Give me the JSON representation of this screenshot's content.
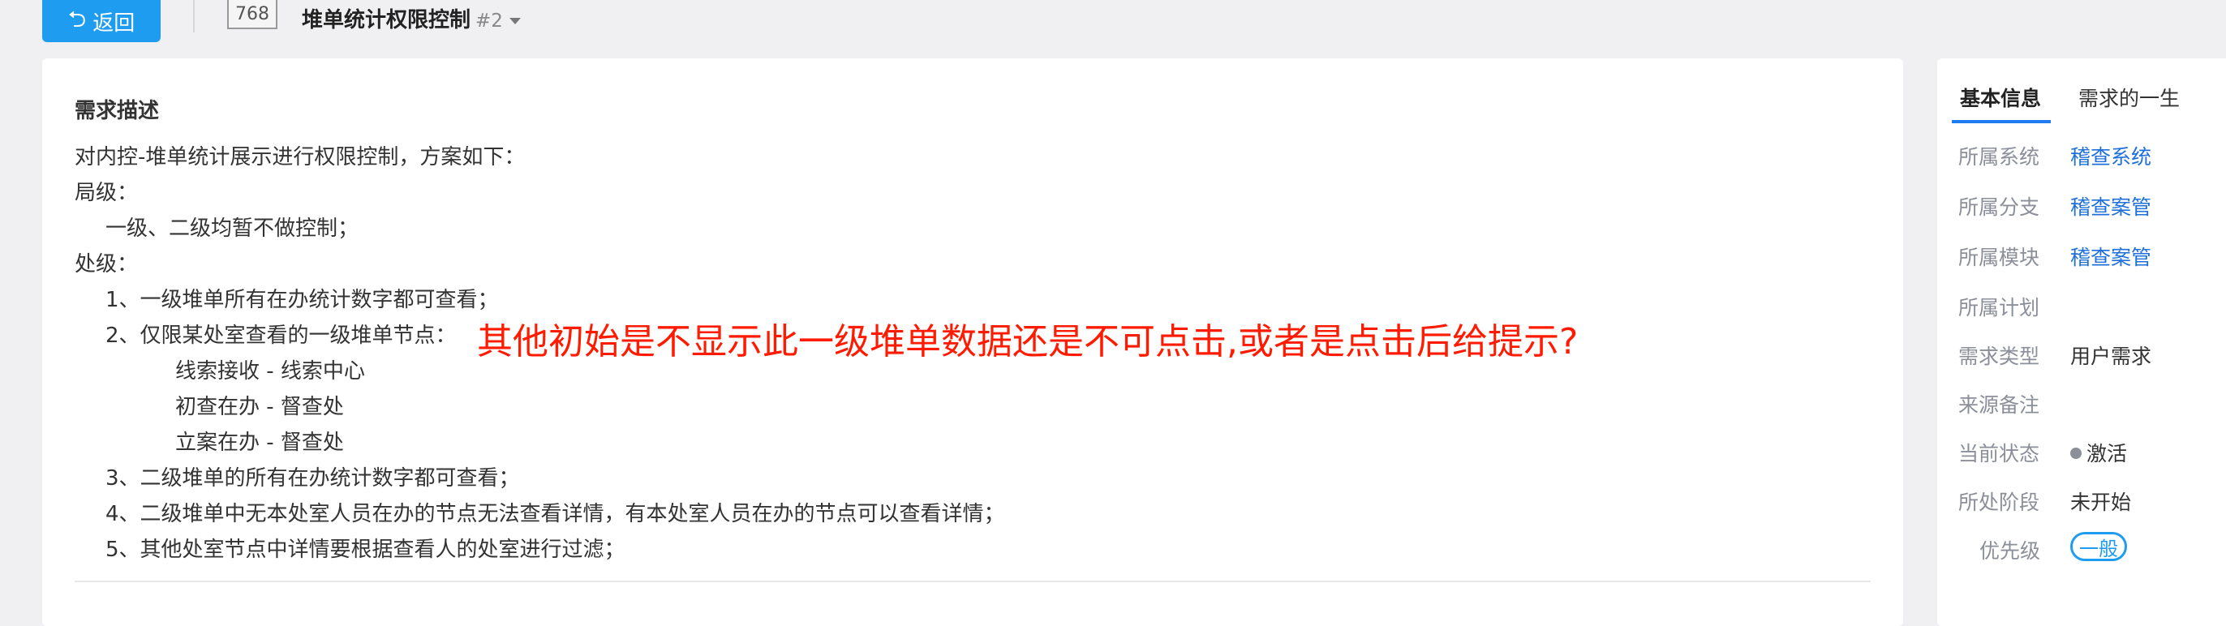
{
  "header": {
    "back_label": "返回",
    "id_number": "768",
    "title": "堆单统计权限控制",
    "title_suffix": "#2"
  },
  "description": {
    "section_title": "需求描述",
    "lines": [
      "对内控-堆单统计展示进行权限控制，方案如下：",
      "局级：",
      "一级、二级均暂不做控制；",
      "处级：",
      "1、一级堆单所有在办统计数字都可查看；",
      "2、仅限某处室查看的一级堆单节点：",
      "线索接收 - 线索中心",
      "初查在办 - 督查处",
      "立案在办 - 督查处",
      "3、二级堆单的所有在办统计数字都可查看；",
      "4、二级堆单中无本处室人员在办的节点无法查看详情，有本处室人员在办的节点可以查看详情；",
      "5、其他处室节点中详情要根据查看人的处室进行过滤；"
    ],
    "annotation": "其他初始是不显示此一级堆单数据还是不可点击,或者是点击后给提示?"
  },
  "side": {
    "tabs": [
      "基本信息",
      "需求的一生"
    ],
    "props": [
      {
        "label": "所属系统",
        "value": "稽查系统"
      },
      {
        "label": "所属分支",
        "value": "稽查案管"
      },
      {
        "label": "所属模块",
        "value": "稽查案管"
      },
      {
        "label": "所属计划",
        "value": ""
      },
      {
        "label": "需求类型",
        "value": "用户需求"
      },
      {
        "label": "来源备注",
        "value": ""
      },
      {
        "label": "当前状态",
        "value": "激活"
      },
      {
        "label": "所处阶段",
        "value": "未开始"
      },
      {
        "label": "优先级",
        "value": "一般"
      }
    ]
  },
  "colors": {
    "accent": "#1e9cf0",
    "link": "#1e6fd9",
    "annotation": "#ff1a00"
  }
}
